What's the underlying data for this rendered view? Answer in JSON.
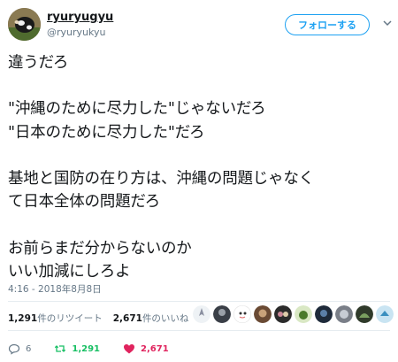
{
  "user": {
    "display_name": "ryuryugyu",
    "handle": "@ryuryukyu"
  },
  "follow_button": {
    "label": "フォローする"
  },
  "tweet": {
    "text": "違うだろ\n\n\"沖縄のために尽力した\"じゃないだろ\n\"日本のために尽力した\"だろ\n\n基地と国防の在り方は、沖縄の問題じゃなく\nて日本全体の問題だろ\n\nお前らまだ分からないのか\nいい加減にしろよ",
    "timestamp": "4:16 - 2018年8月8日"
  },
  "stats": {
    "retweets_count": "1,291",
    "retweets_label": "件のリツイート",
    "likes_count": "2,671",
    "likes_label": "件のいいね"
  },
  "actions": {
    "reply_count": "6",
    "retweet_count": "1,291",
    "like_count": "2,671"
  },
  "colors": {
    "twitter_blue": "#1da1f2",
    "retweet_green": "#17bf63",
    "like_red": "#e0245e",
    "muted_gray": "#657786"
  }
}
